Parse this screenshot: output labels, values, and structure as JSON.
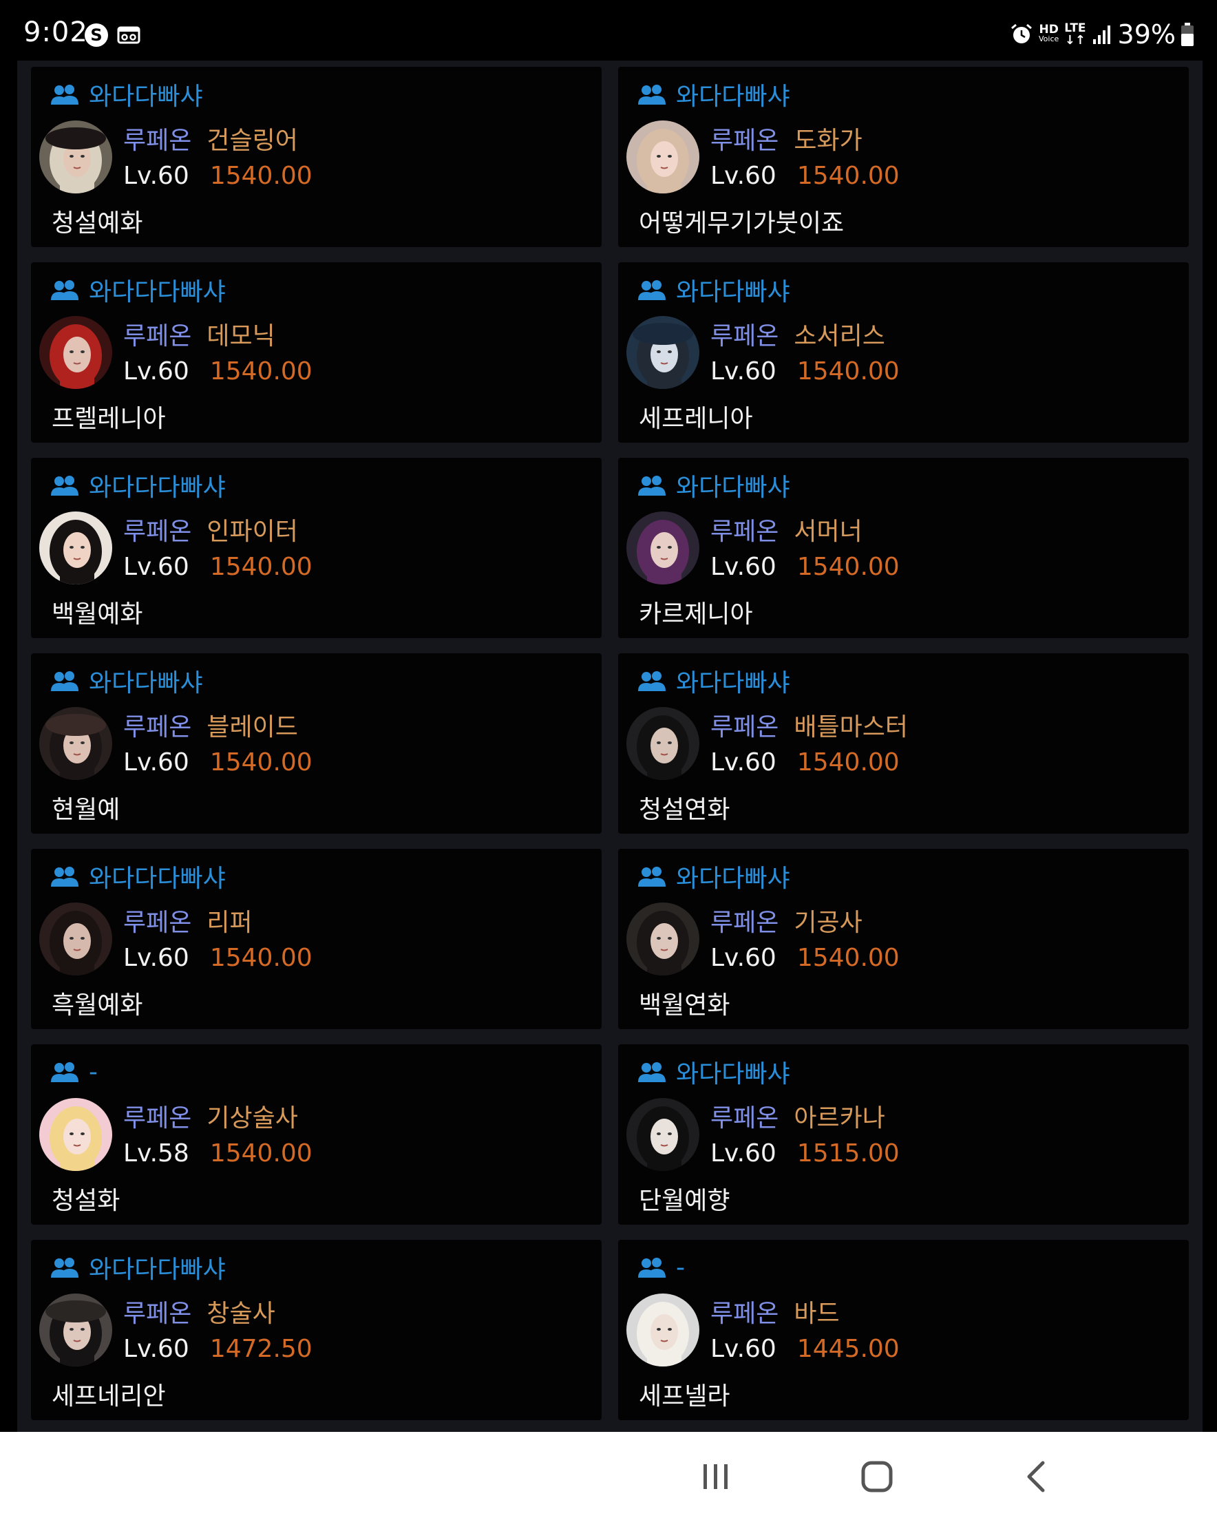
{
  "status_bar": {
    "time": "9:02",
    "app_icon_s": "S",
    "network_hd": "HD",
    "network_voice": "Voice",
    "network_lte": "LTE",
    "battery_percent": "39%",
    "icons": [
      "s-app-icon",
      "vr-box-icon",
      "alarm-icon",
      "hd-voice-icon",
      "lte-icon",
      "signal-icon",
      "battery-icon"
    ]
  },
  "cards": [
    {
      "guild": "와다다빠샤",
      "server": "루페온",
      "class": "건슬링어",
      "level": "Lv.60",
      "item_level": "1540.00",
      "name": "청설예화",
      "avatar": "portrait-gunslinger"
    },
    {
      "guild": "와다다빠샤",
      "server": "루페온",
      "class": "도화가",
      "level": "Lv.60",
      "item_level": "1540.00",
      "name": "어떻게무기가붓이죠",
      "avatar": "portrait-artist"
    },
    {
      "guild": "와다다다빠샤",
      "server": "루페온",
      "class": "데모닉",
      "level": "Lv.60",
      "item_level": "1540.00",
      "name": "프렐레니아",
      "avatar": "portrait-demonic"
    },
    {
      "guild": "와다다빠샤",
      "server": "루페온",
      "class": "소서리스",
      "level": "Lv.60",
      "item_level": "1540.00",
      "name": "세프레니아",
      "avatar": "portrait-sorceress"
    },
    {
      "guild": "와다다다빠샤",
      "server": "루페온",
      "class": "인파이터",
      "level": "Lv.60",
      "item_level": "1540.00",
      "name": "백월예화",
      "avatar": "portrait-infighter"
    },
    {
      "guild": "와다다빠샤",
      "server": "루페온",
      "class": "서머너",
      "level": "Lv.60",
      "item_level": "1540.00",
      "name": "카르제니아",
      "avatar": "portrait-summoner"
    },
    {
      "guild": "와다다빠샤",
      "server": "루페온",
      "class": "블레이드",
      "level": "Lv.60",
      "item_level": "1540.00",
      "name": "현월예",
      "avatar": "portrait-blade"
    },
    {
      "guild": "와다다빠샤",
      "server": "루페온",
      "class": "배틀마스터",
      "level": "Lv.60",
      "item_level": "1540.00",
      "name": "청설연화",
      "avatar": "portrait-battlemaster"
    },
    {
      "guild": "와다다다빠샤",
      "server": "루페온",
      "class": "리퍼",
      "level": "Lv.60",
      "item_level": "1540.00",
      "name": "흑월예화",
      "avatar": "portrait-reaper"
    },
    {
      "guild": "와다다빠샤",
      "server": "루페온",
      "class": "기공사",
      "level": "Lv.60",
      "item_level": "1540.00",
      "name": "백월연화",
      "avatar": "portrait-soulfist"
    },
    {
      "guild": "-",
      "server": "루페온",
      "class": "기상술사",
      "level": "Lv.58",
      "item_level": "1540.00",
      "name": "청설화",
      "avatar": "portrait-aeromancer"
    },
    {
      "guild": "와다다빠샤",
      "server": "루페온",
      "class": "아르카나",
      "level": "Lv.60",
      "item_level": "1515.00",
      "name": "단월예향",
      "avatar": "portrait-arcana"
    },
    {
      "guild": "와다다다빠샤",
      "server": "루페온",
      "class": "창술사",
      "level": "Lv.60",
      "item_level": "1472.50",
      "name": "세프네리안",
      "avatar": "portrait-lancemaster"
    },
    {
      "guild": "-",
      "server": "루페온",
      "class": "바드",
      "level": "Lv.60",
      "item_level": "1445.00",
      "name": "세프넬라",
      "avatar": "portrait-bard"
    }
  ],
  "colors": {
    "background": "#000000",
    "panel": "#15161b",
    "card": "#030304",
    "guild_blue": "#2a8ed8",
    "server_purple": "#7f8fe6",
    "class_orange": "#d79a5a",
    "item_level_orange": "#d46a25"
  },
  "nav_bar": {
    "icons": [
      "recent-apps-icon",
      "home-icon",
      "back-icon"
    ]
  }
}
